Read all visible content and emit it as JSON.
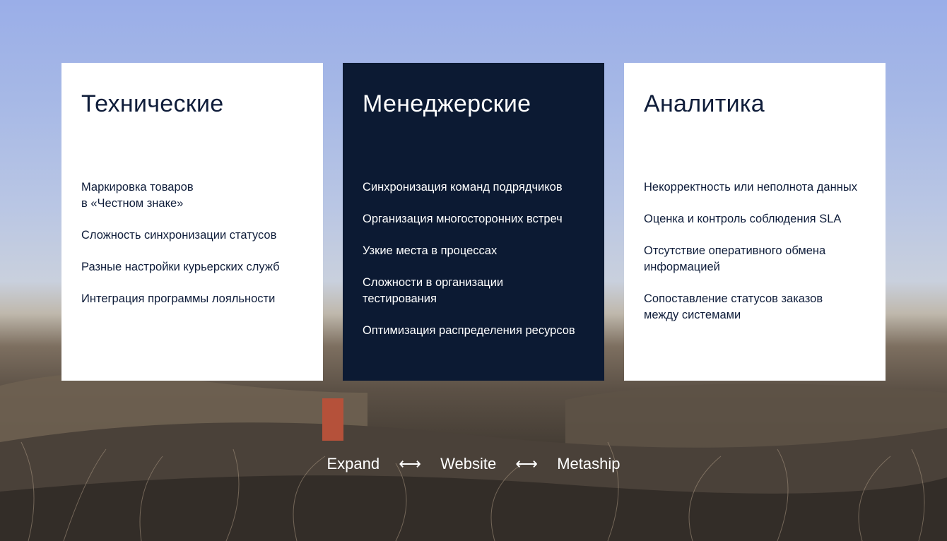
{
  "cards": [
    {
      "title": "Технические",
      "items": [
        "Маркировка товаров\nв «Честном знаке»",
        "Сложность синхронизации статусов",
        "Разные настройки курьерских служб",
        "Интеграция программы лояльности"
      ]
    },
    {
      "title": "Менеджерские",
      "items": [
        "Синхронизация команд подрядчиков",
        "Организация многосторонних встреч",
        "Узкие места в процессах",
        "Сложности в организации\nтестирования",
        "Оптимизация распределения ресурсов"
      ]
    },
    {
      "title": "Аналитика",
      "items": [
        "Некорректность или неполнота данных",
        "Оценка и контроль соблюдения SLA",
        "Отсутствие оперативного обмена\nинформацией",
        "Сопоставление статусов заказов\nмежду системами"
      ]
    }
  ],
  "footer": {
    "items": [
      "Expand",
      "Website",
      "Metaship"
    ],
    "separator": "⟷"
  },
  "colors": {
    "card_light_bg": "#ffffff",
    "card_dark_bg": "#0c1a33",
    "text_dark": "#0f1d3a",
    "text_light": "#ffffff"
  }
}
